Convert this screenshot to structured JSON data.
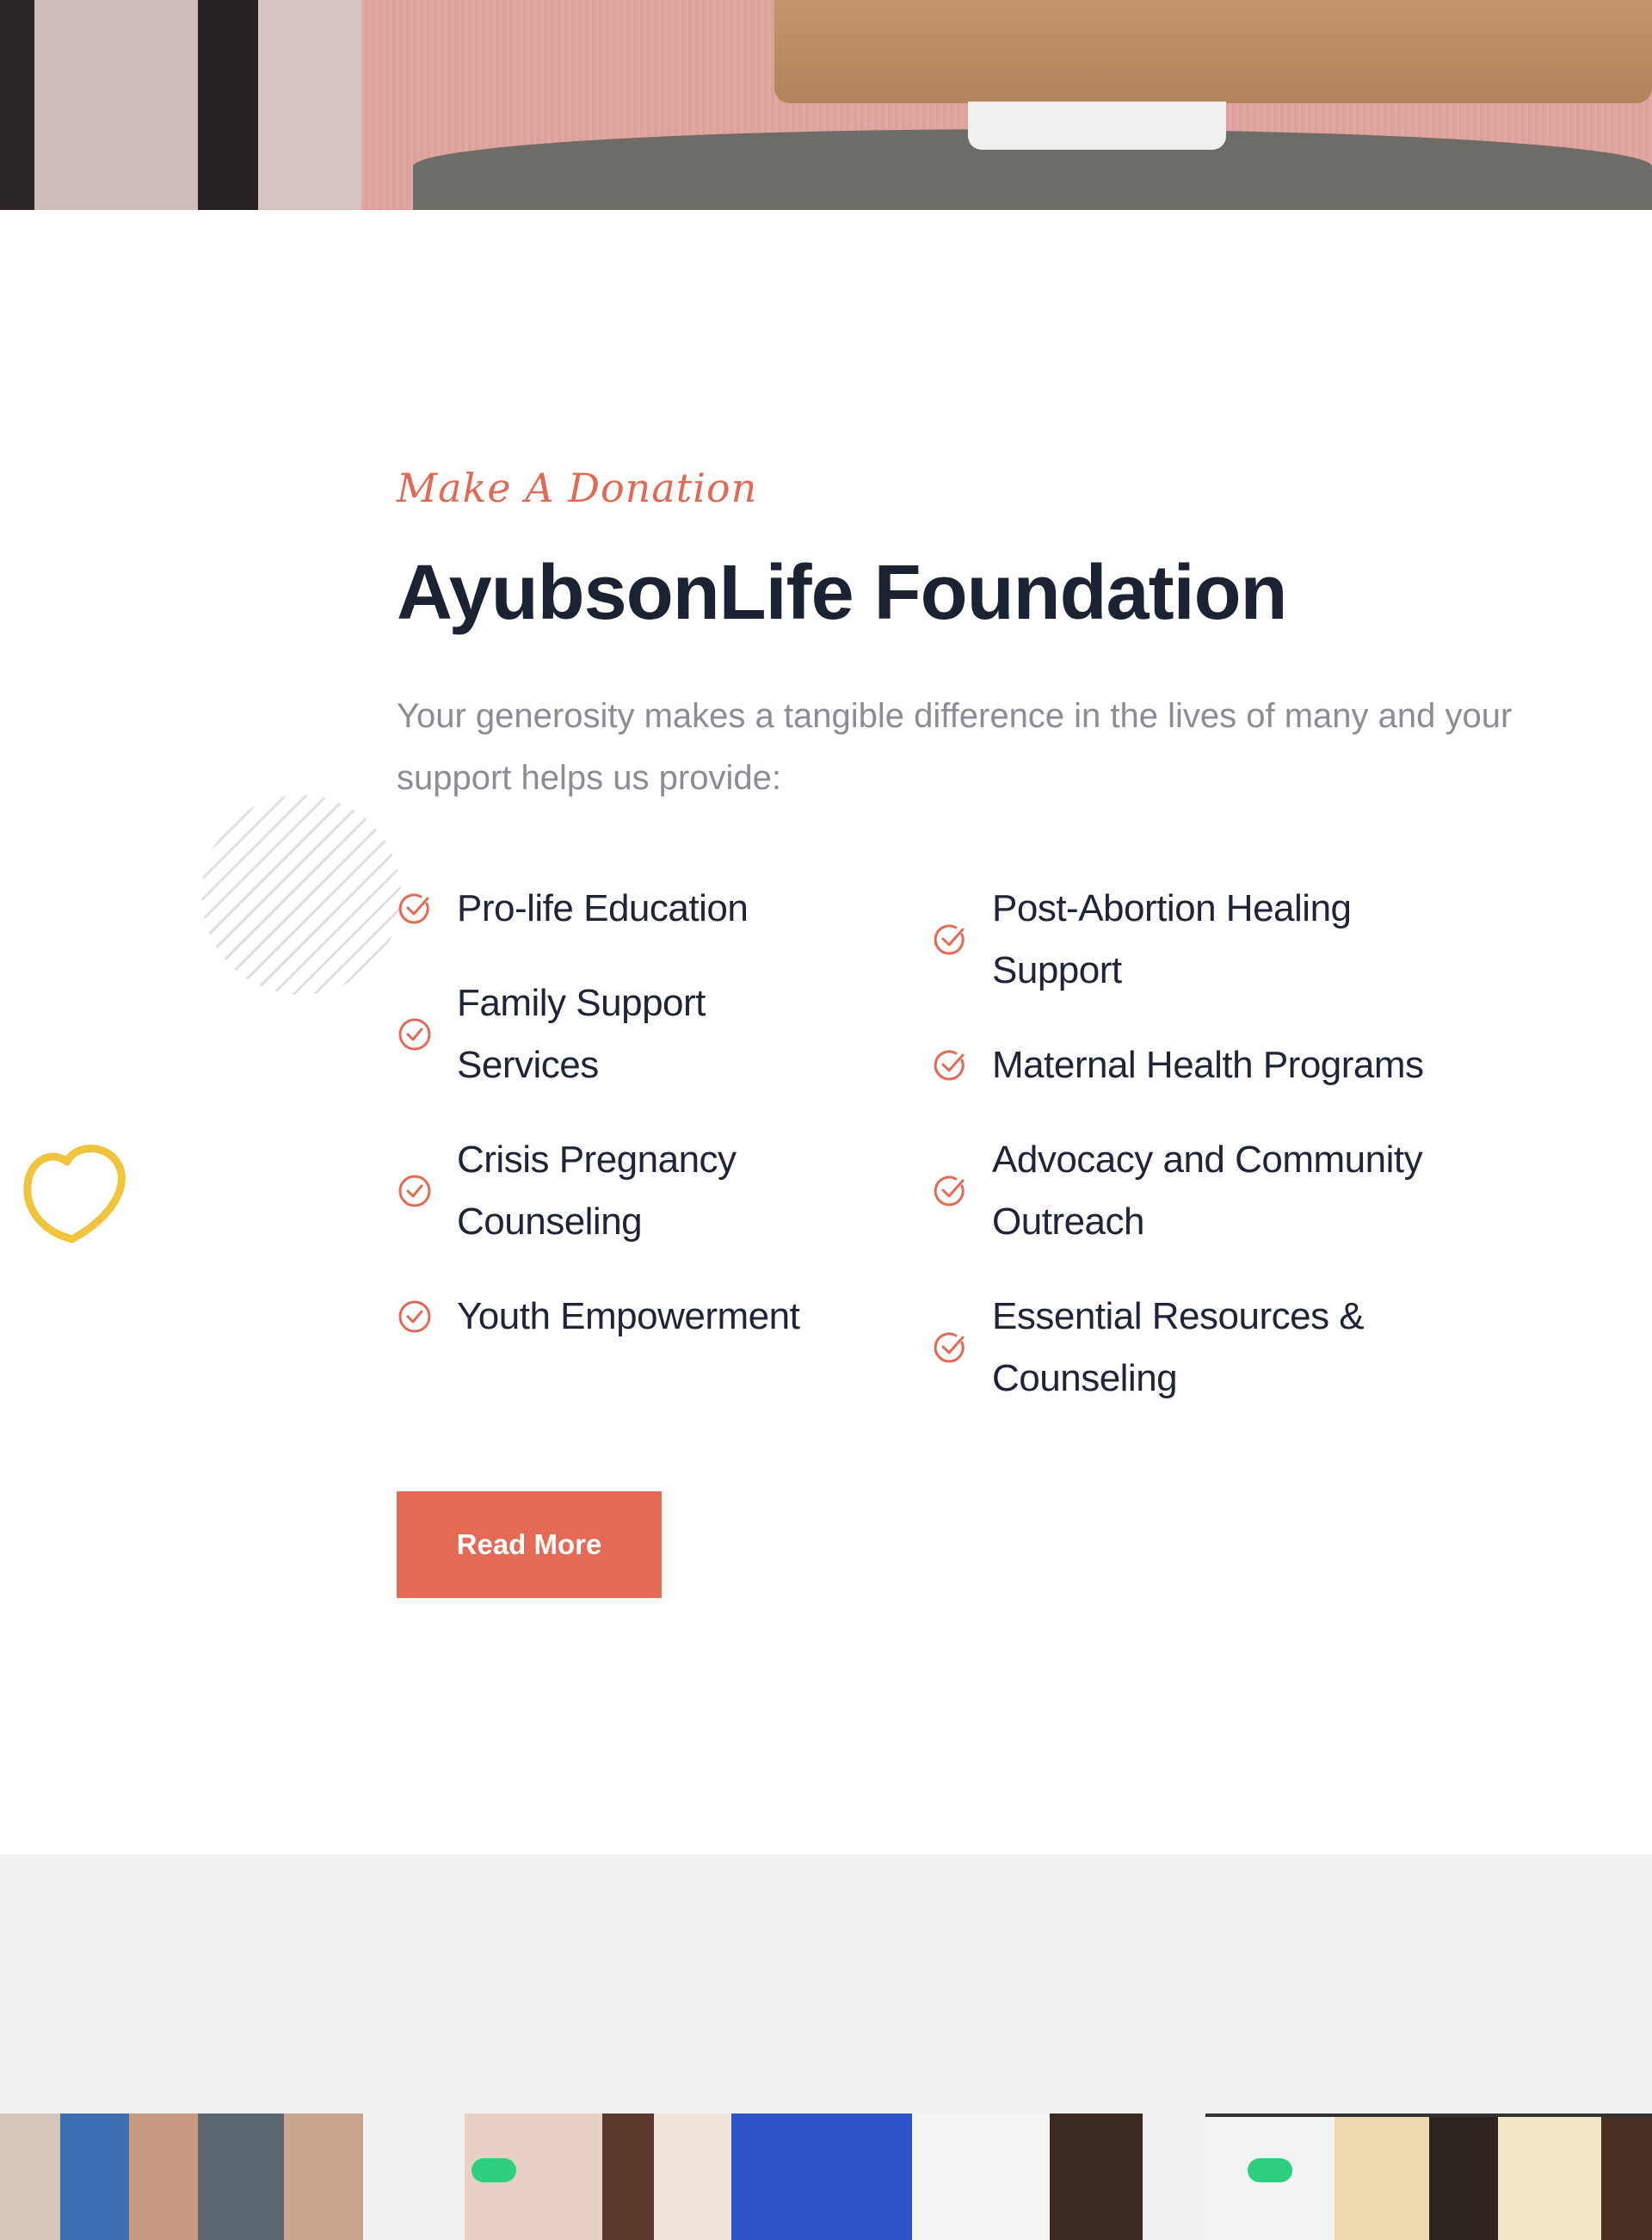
{
  "donation": {
    "eyebrow": "Make A Donation",
    "title": "AyubsonLife Foundation",
    "intro": "Your generosity makes a tangible difference in the lives of many and your support helps us provide:",
    "features_left": [
      "Pro-life Education",
      "Family Support Services",
      "Crisis Pregnancy Counseling",
      "Youth Empowerment"
    ],
    "features_right": [
      "Post-Abortion Healing Support",
      "Maternal Health Programs",
      "Advocacy and Community Outreach",
      "Essential Resources & Counseling"
    ],
    "button_label": "Read More"
  },
  "icons": {
    "check": "check-circle-icon",
    "decor": "heart-outline-icon"
  },
  "colors": {
    "accent": "#e36a55",
    "heading": "#1b2232",
    "muted": "#8a8d93",
    "heart": "#f0c43c",
    "section_bg": "#f1f1f1",
    "tag": "#2ecf7f"
  }
}
